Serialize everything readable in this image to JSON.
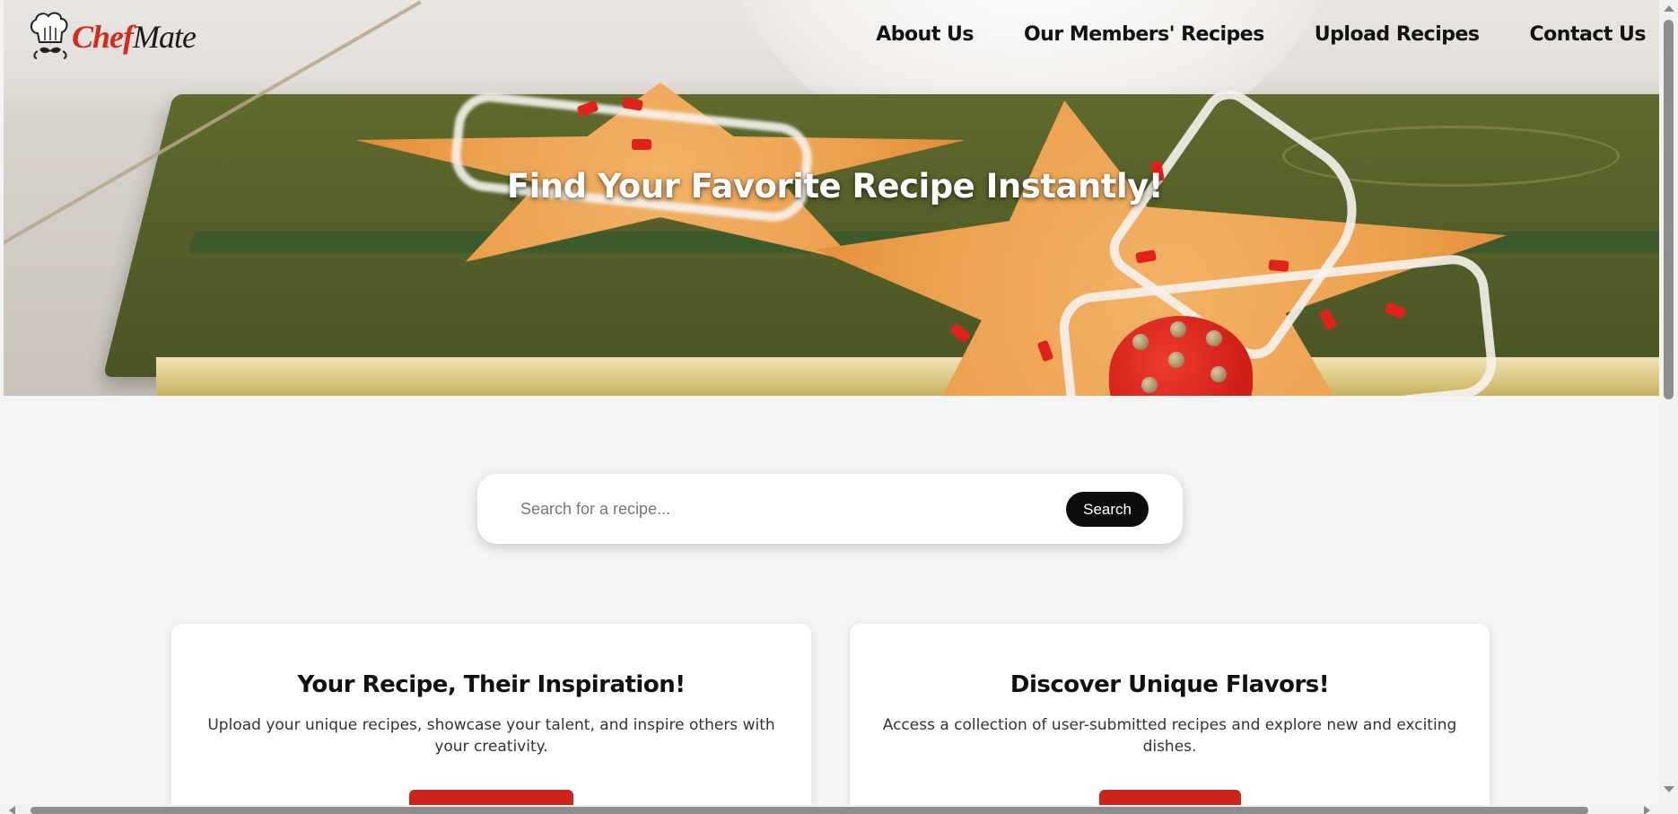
{
  "brand": {
    "name_part1": "Chef",
    "name_part2": "Mate",
    "accent_color": "#d62a1e",
    "logo_icon": "chef-hat-mustache-icon"
  },
  "nav": {
    "items": [
      {
        "label": "About Us"
      },
      {
        "label": "Our Members' Recipes"
      },
      {
        "label": "Upload Recipes"
      },
      {
        "label": "Contact Us"
      }
    ]
  },
  "hero": {
    "title": "Find Your Favorite Recipe Instantly!"
  },
  "search": {
    "placeholder": "Search for a recipe...",
    "value": "",
    "button_label": "Search"
  },
  "cards": [
    {
      "title": "Your Recipe, Their Inspiration!",
      "description": "Upload your unique recipes, showcase your talent, and inspire others with your creativity.",
      "button_color": "#cf2419"
    },
    {
      "title": "Discover Unique Flavors!",
      "description": "Access a collection of user-submitted recipes and explore new and exciting dishes.",
      "button_color": "#cf2419"
    }
  ]
}
